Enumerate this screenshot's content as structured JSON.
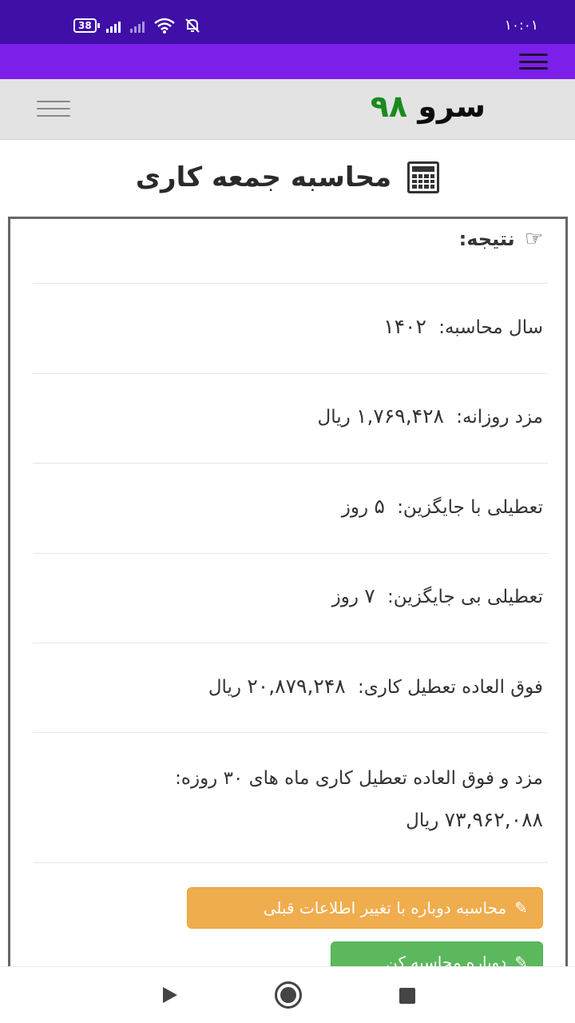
{
  "status_bar": {
    "time": "۱۰:۰۱",
    "battery": "38",
    "icons": [
      "battery-icon",
      "signal-icon",
      "signal-weak-icon",
      "wifi-icon",
      "notifications-off-icon"
    ]
  },
  "app_bar": {
    "menu_icon": "hamburger-menu-icon"
  },
  "site_header": {
    "logo_word": "سرو",
    "logo_number": "۹۸",
    "menu_icon": "hamburger-menu-icon"
  },
  "page": {
    "title": "محاسبه جمعه کاری",
    "title_icon": "calculator-icon"
  },
  "result": {
    "heading": "نتیجه:",
    "heading_icon": "hand-pointer-icon",
    "rows": [
      {
        "label": "سال محاسبه:",
        "value": "۱۴۰۲",
        "unit": ""
      },
      {
        "label": "مزد روزانه:",
        "value": "۱,۷۶۹,۴۲۸",
        "unit": "ریال"
      },
      {
        "label": "تعطیلی با جایگزین:",
        "value": "۵",
        "unit": "روز"
      },
      {
        "label": "تعطیلی بی جایگزین:",
        "value": "۷",
        "unit": "روز"
      },
      {
        "label": "فوق العاده تعطیل کاری:",
        "value": "۲۰,۸۷۹,۲۴۸",
        "unit": "ریال"
      },
      {
        "label": "مزد و فوق العاده تعطیل کاری ماه های ۳۰ روزه:",
        "value": "۷۳,۹۶۲,۰۸۸",
        "unit": "ریال"
      }
    ],
    "buttons": {
      "recalc_change": "محاسبه دوباره با تغییر اطلاعات قبلی",
      "recalc": "دوباره محاسبه کن"
    }
  },
  "nav_bar": {
    "icons": [
      "back-icon",
      "home-icon",
      "recents-icon"
    ]
  },
  "colors": {
    "status_bar": "#3f0fa8",
    "app_bar": "#7c1fea",
    "logo_number": "#1a8a1f",
    "button_orange": "#f0ad4e",
    "button_green": "#5cb85c"
  }
}
